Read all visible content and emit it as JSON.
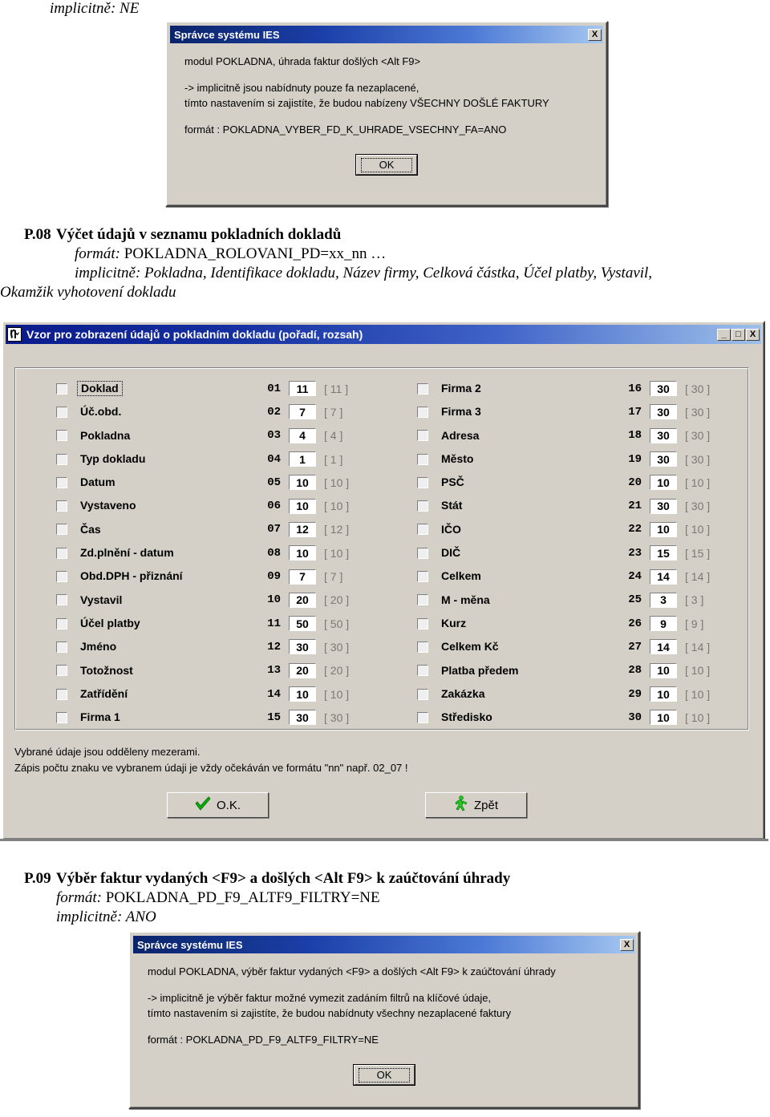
{
  "document": {
    "implicitne_ne": "implicitně: NE",
    "p08": {
      "number": "P.08",
      "title": "Výčet údajů v seznamu pokladních dokladů",
      "format_label": "formát:",
      "format_value": "POKLADNA_ROLOVANI_PD=xx_nn …",
      "implicit_line1": "implicitně: Pokladna, Identifikace dokladu, Název firmy, Celková částka, Účel platby, Vystavil,",
      "implicit_line2": "Okamžik vyhotovení dokladu"
    },
    "p09": {
      "number": "P.09",
      "title": "Výběr faktur vydaných <F9> a došlých <Alt F9> k zaúčtování úhrady",
      "format_label": "formát:",
      "format_value": "POKLADNA_PD_F9_ALTF9_FILTRY=NE",
      "implicit": "implicitně: ANO"
    }
  },
  "dialog_top": {
    "title": "Správce systému IES",
    "close_label": "X",
    "para1": "modul POKLADNA, úhrada faktur došlých <Alt F9>",
    "para2_line1": "-> implicitně jsou nabídnuty pouze fa nezaplacené,",
    "para2_line2": "tímto nastavením si zajistíte, že budou nabízeny VŠECHNY DOŠLÉ FAKTURY",
    "para3": "formát : POKLADNA_VYBER_FD_K_UHRADE_VSECHNY_FA=ANO",
    "ok_label": "OK"
  },
  "dialog_bottom": {
    "title": "Správce systému IES",
    "close_label": "X",
    "para1": "modul POKLADNA, výběr faktur vydaných <F9> a došlých  <Alt F9> k zaúčtování úhrady",
    "para2_line1": "-> implicitně je výběr faktur možné vymezit zadáním filtrů na klíčové údaje,",
    "para2_line2": "tímto nastavením si zajistíte, že budou nabídnuty všechny nezaplacené faktury",
    "para3": "formát : POKLADNA_PD_F9_ALTF9_FILTRY=NE",
    "ok_label": "OK"
  },
  "vzor_window": {
    "title": "Vzor pro zobrazení údajů o pokladním dokladu (pořadí, rozsah)",
    "minimize_label": "_",
    "maximize_label": "□",
    "close_label": "X",
    "notes": [
      "Vybrané údaje jsou odděleny mezerami.",
      "Zápis počtu znaku ve vybranem údaji je vždy očekáván ve formátu \"nn\" např. 02_07 !"
    ],
    "buttons": {
      "ok": "O.K.",
      "back": "Zpět"
    },
    "fields_left": [
      {
        "label": "Doklad",
        "index": "01",
        "value": "11",
        "max": "[ 11 ]",
        "focused": true
      },
      {
        "label": "Úč.obd.",
        "index": "02",
        "value": "7",
        "max": "[ 7 ]",
        "focused": false
      },
      {
        "label": "Pokladna",
        "index": "03",
        "value": "4",
        "max": "[ 4 ]",
        "focused": false
      },
      {
        "label": "Typ dokladu",
        "index": "04",
        "value": "1",
        "max": "[ 1 ]",
        "focused": false
      },
      {
        "label": "Datum",
        "index": "05",
        "value": "10",
        "max": "[ 10 ]",
        "focused": false
      },
      {
        "label": "Vystaveno",
        "index": "06",
        "value": "10",
        "max": "[ 10 ]",
        "focused": false
      },
      {
        "label": "Čas",
        "index": "07",
        "value": "12",
        "max": "[ 12 ]",
        "focused": false
      },
      {
        "label": "Zd.plnění - datum",
        "index": "08",
        "value": "10",
        "max": "[ 10 ]",
        "focused": false
      },
      {
        "label": "Obd.DPH - přiznání",
        "index": "09",
        "value": "7",
        "max": "[ 7 ]",
        "focused": false
      },
      {
        "label": "Vystavil",
        "index": "10",
        "value": "20",
        "max": "[ 20 ]",
        "focused": false
      },
      {
        "label": "Účel platby",
        "index": "11",
        "value": "50",
        "max": "[ 50 ]",
        "focused": false
      },
      {
        "label": "Jméno",
        "index": "12",
        "value": "30",
        "max": "[ 30 ]",
        "focused": false
      },
      {
        "label": "Totožnost",
        "index": "13",
        "value": "20",
        "max": "[ 20 ]",
        "focused": false
      },
      {
        "label": "Zatřídění",
        "index": "14",
        "value": "10",
        "max": "[ 10 ]",
        "focused": false
      },
      {
        "label": "Firma 1",
        "index": "15",
        "value": "30",
        "max": "[ 30 ]",
        "focused": false
      }
    ],
    "fields_right": [
      {
        "label": "Firma 2",
        "index": "16",
        "value": "30",
        "max": "[ 30 ]",
        "focused": false
      },
      {
        "label": "Firma 3",
        "index": "17",
        "value": "30",
        "max": "[ 30 ]",
        "focused": false
      },
      {
        "label": "Adresa",
        "index": "18",
        "value": "30",
        "max": "[ 30 ]",
        "focused": false
      },
      {
        "label": "Město",
        "index": "19",
        "value": "30",
        "max": "[ 30 ]",
        "focused": false
      },
      {
        "label": "PSČ",
        "index": "20",
        "value": "10",
        "max": "[ 10 ]",
        "focused": false
      },
      {
        "label": "Stát",
        "index": "21",
        "value": "30",
        "max": "[ 30 ]",
        "focused": false
      },
      {
        "label": "IČO",
        "index": "22",
        "value": "10",
        "max": "[ 10 ]",
        "focused": false
      },
      {
        "label": "DIČ",
        "index": "23",
        "value": "15",
        "max": "[ 15 ]",
        "focused": false
      },
      {
        "label": "Celkem",
        "index": "24",
        "value": "14",
        "max": "[ 14 ]",
        "focused": false
      },
      {
        "label": "M - měna",
        "index": "25",
        "value": "3",
        "max": "[ 3 ]",
        "focused": false
      },
      {
        "label": "Kurz",
        "index": "26",
        "value": "9",
        "max": "[ 9 ]",
        "focused": false
      },
      {
        "label": "Celkem Kč",
        "index": "27",
        "value": "14",
        "max": "[ 14 ]",
        "focused": false
      },
      {
        "label": "Platba předem",
        "index": "28",
        "value": "10",
        "max": "[ 10 ]",
        "focused": false
      },
      {
        "label": "Zakázka",
        "index": "29",
        "value": "10",
        "max": "[ 10 ]",
        "focused": false
      },
      {
        "label": "Středisko",
        "index": "30",
        "value": "10",
        "max": "[ 10 ]",
        "focused": false
      }
    ]
  },
  "colors": {
    "window_face": "#d4d0c8",
    "title_blue": "#0a246a",
    "ok_check_green": "#00c000",
    "field_white": "#ffffff"
  }
}
